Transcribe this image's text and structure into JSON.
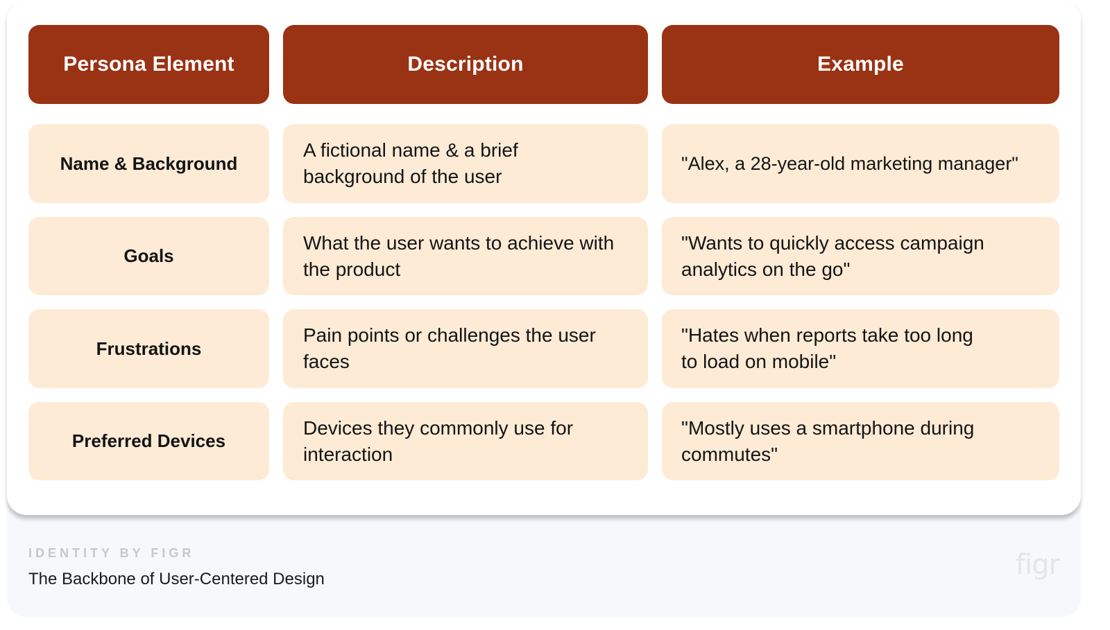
{
  "table": {
    "headers": [
      "Persona Element",
      "Description",
      "Example"
    ],
    "rows": [
      {
        "element": "Name & Background",
        "description": "A fictional name & a brief background of the user",
        "example": "\"Alex, a 28-year-old marketing manager\""
      },
      {
        "element": "Goals",
        "description": "What the user wants to achieve with the product",
        "example": "\"Wants to quickly access campaign analytics on the go\""
      },
      {
        "element": "Frustrations",
        "description": "Pain points or challenges the user faces",
        "example": "\"Hates when reports take too long to load on mobile\""
      },
      {
        "element": "Preferred Devices",
        "description": "Devices they commonly use for interaction",
        "example": "\"Mostly uses a smartphone during commutes\""
      }
    ]
  },
  "footer": {
    "kicker": "IDENTITY BY FIGR",
    "title": "The Backbone of User-Centered Design",
    "brand": "figr"
  },
  "colors": {
    "header_bg": "#9a3214",
    "cell_bg": "#fdebd6",
    "footer_bg": "#f7f8fc"
  }
}
